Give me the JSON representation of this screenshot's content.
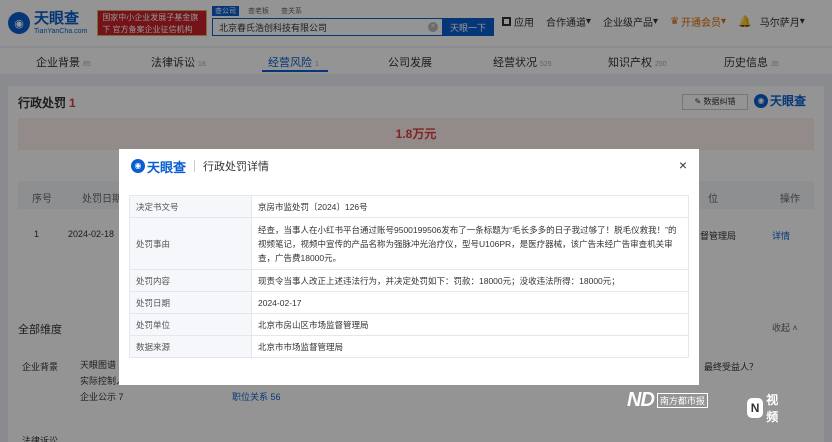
{
  "header": {
    "logo_cn": "天眼查",
    "logo_en": "TianYanCha.com",
    "promo": "国家中小企业发展子基金旗下 官方备案企业征信机构",
    "search_tabs": [
      "查公司",
      "查老板",
      "查关系"
    ],
    "search_value": "北京春氏浩创科技有限公司",
    "search_button": "天眼一下",
    "nav": {
      "apps": "应用",
      "cooperation": "合作通道",
      "enterprise": "企业级产品",
      "vip": "开通会员",
      "user": "马尔萨月"
    }
  },
  "tabs": [
    {
      "label": "企业背景",
      "count": "85"
    },
    {
      "label": "法律诉讼",
      "count": "18"
    },
    {
      "label": "经营风险",
      "count": "1"
    },
    {
      "label": "公司发展",
      "count": ""
    },
    {
      "label": "经营状况",
      "count": "525"
    },
    {
      "label": "知识产权",
      "count": "250"
    },
    {
      "label": "历史信息",
      "count": "35"
    }
  ],
  "panel": {
    "title": "行政处罚",
    "title_count": "1",
    "export": "数据纠错",
    "logo": "天眼查",
    "amount": "1.8万元",
    "columns": {
      "seq": "序号",
      "date": "处罚日期",
      "unit_col": "位",
      "action": "操作"
    },
    "row": {
      "seq": "1",
      "date": "2024-02-18",
      "unit": "督管理局",
      "detail": "详情"
    }
  },
  "section": {
    "title": "全部维度",
    "collapse": "收起",
    "rows": [
      {
        "label": "企业背景",
        "items": [
          "天眼图谱",
          "实际控制人",
          "企业公示 7",
          "最终受益人？"
        ]
      },
      {
        "label": "法律诉讼",
        "items": []
      }
    ],
    "extra": "职位关系 56"
  },
  "modal": {
    "logo": "天眼查",
    "title": "行政处罚详情",
    "close": "×",
    "rows": [
      {
        "key": "决定书文号",
        "value": "京房市监处罚〔2024〕126号"
      },
      {
        "key": "处罚事由",
        "value": "经查，当事人在小红书平台通过账号9500199506发布了一条标题为“毛长多多的日子我过够了！脱毛仪救我！”的视频笔记，视频中宣传的产品名称为强脉冲光治疗仪，型号U106PR，是医疗器械，该广告未经广告审查机关审查，广告费18000元。"
      },
      {
        "key": "处罚内容",
        "value": "现责令当事人改正上述违法行为，并决定处罚如下：罚款：18000元；没收违法所得：18000元；"
      },
      {
        "key": "处罚日期",
        "value": "2024-02-17"
      },
      {
        "key": "处罚单位",
        "value": "北京市房山区市场监督管理局"
      },
      {
        "key": "数据来源",
        "value": "北京市市场监督管理局"
      }
    ]
  },
  "watermark": {
    "nd": "ND",
    "paper": "南方都市报",
    "n": "N",
    "video": "视频"
  }
}
